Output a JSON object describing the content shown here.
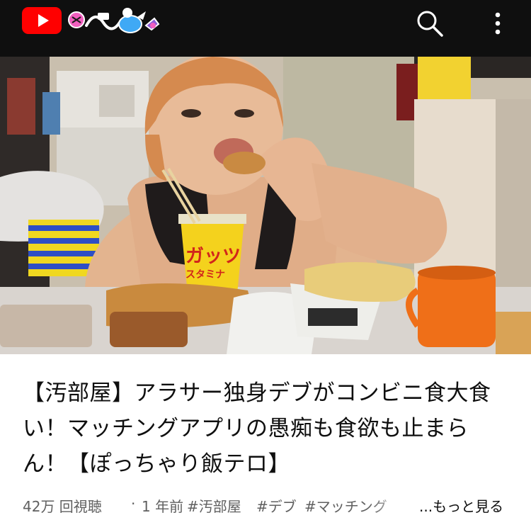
{
  "header": {
    "search_icon": "search-icon",
    "more_icon": "more-vert-icon",
    "brand_color": "#ff0000"
  },
  "video": {
    "title": "【汚部屋】アラサー独身デブがコンビニ食大食い！マッチングアプリの愚痴も食欲も止まらん！【ぽっちゃり飯テロ】",
    "views": "42万 回視聴",
    "separator": "·",
    "age": "1 年前",
    "hashtags": [
      "#汚部屋",
      "#デブ",
      "#マッチング"
    ],
    "more_label": "...もっと見る",
    "cup_text": "ガッツ",
    "cup_subtext": "スタミナ"
  }
}
